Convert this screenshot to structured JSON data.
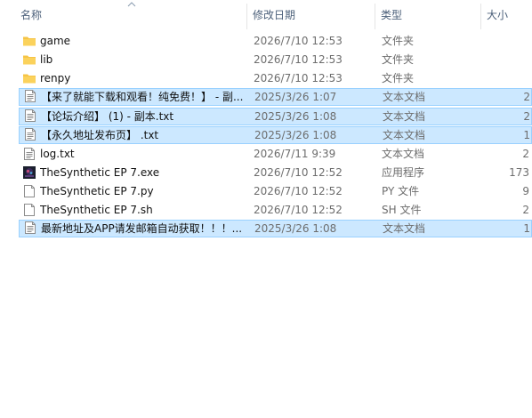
{
  "columns": {
    "name": "名称",
    "modified": "修改日期",
    "type": "类型",
    "size": "大小"
  },
  "rows": [
    {
      "name": "game",
      "modified": "2026/7/10 12:53",
      "type": "文件夹",
      "size": "",
      "icon": "folder-icon",
      "selected": false
    },
    {
      "name": "lib",
      "modified": "2026/7/10 12:53",
      "type": "文件夹",
      "size": "",
      "icon": "folder-icon",
      "selected": false
    },
    {
      "name": "renpy",
      "modified": "2026/7/10 12:53",
      "type": "文件夹",
      "size": "",
      "icon": "folder-icon",
      "selected": false
    },
    {
      "name": "【来了就能下载和观看！纯免费！】 - 副...",
      "modified": "2025/3/26 1:07",
      "type": "文本文档",
      "size": "2",
      "icon": "text-file-icon",
      "selected": true
    },
    {
      "name": "【论坛介绍】 (1) - 副本.txt",
      "modified": "2025/3/26 1:08",
      "type": "文本文档",
      "size": "2",
      "icon": "text-file-icon",
      "selected": true
    },
    {
      "name": "【永久地址发布页】 .txt",
      "modified": "2025/3/26 1:08",
      "type": "文本文档",
      "size": "1",
      "icon": "text-file-icon",
      "selected": true
    },
    {
      "name": "log.txt",
      "modified": "2026/7/11 9:39",
      "type": "文本文档",
      "size": "2",
      "icon": "text-file-icon",
      "selected": false
    },
    {
      "name": "TheSynthetic EP 7.exe",
      "modified": "2026/7/10 12:52",
      "type": "应用程序",
      "size": "173",
      "icon": "app-exe-icon",
      "selected": false
    },
    {
      "name": "TheSynthetic EP 7.py",
      "modified": "2026/7/10 12:52",
      "type": "PY 文件",
      "size": "9",
      "icon": "blank-file-icon",
      "selected": false
    },
    {
      "name": "TheSynthetic EP 7.sh",
      "modified": "2026/7/10 12:52",
      "type": "SH 文件",
      "size": "2",
      "icon": "blank-file-icon",
      "selected": false
    },
    {
      "name": "最新地址及APP请发邮箱自动获取！！！...",
      "modified": "2025/3/26 1:08",
      "type": "文本文档",
      "size": "1",
      "icon": "text-file-icon",
      "selected": true
    }
  ]
}
